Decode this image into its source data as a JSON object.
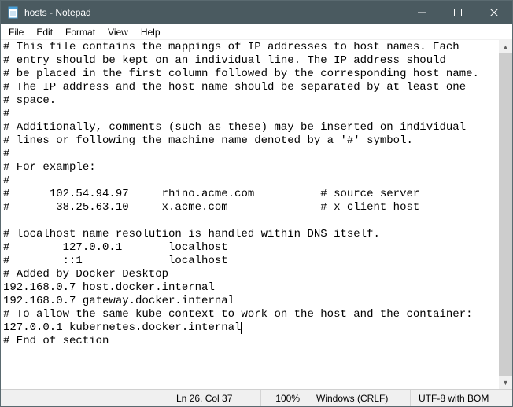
{
  "titlebar": {
    "title": "hosts - Notepad"
  },
  "menu": {
    "file": "File",
    "edit": "Edit",
    "format": "Format",
    "view": "View",
    "help": "Help"
  },
  "document": {
    "lines": [
      "# This file contains the mappings of IP addresses to host names. Each",
      "# entry should be kept on an individual line. The IP address should",
      "# be placed in the first column followed by the corresponding host name.",
      "# The IP address and the host name should be separated by at least one",
      "# space.",
      "#",
      "# Additionally, comments (such as these) may be inserted on individual",
      "# lines or following the machine name denoted by a '#' symbol.",
      "#",
      "# For example:",
      "#",
      "#      102.54.94.97     rhino.acme.com          # source server",
      "#       38.25.63.10     x.acme.com              # x client host",
      "",
      "# localhost name resolution is handled within DNS itself.",
      "#\t127.0.0.1       localhost",
      "#\t::1             localhost",
      "# Added by Docker Desktop",
      "192.168.0.7 host.docker.internal",
      "192.168.0.7 gateway.docker.internal",
      "# To allow the same kube context to work on the host and the container:",
      "127.0.0.1 kubernetes.docker.internal",
      "# End of section"
    ],
    "caret_line_index": 21
  },
  "status": {
    "position": "Ln 26, Col 37",
    "zoom": "100%",
    "line_ending": "Windows (CRLF)",
    "encoding": "UTF-8 with BOM"
  }
}
